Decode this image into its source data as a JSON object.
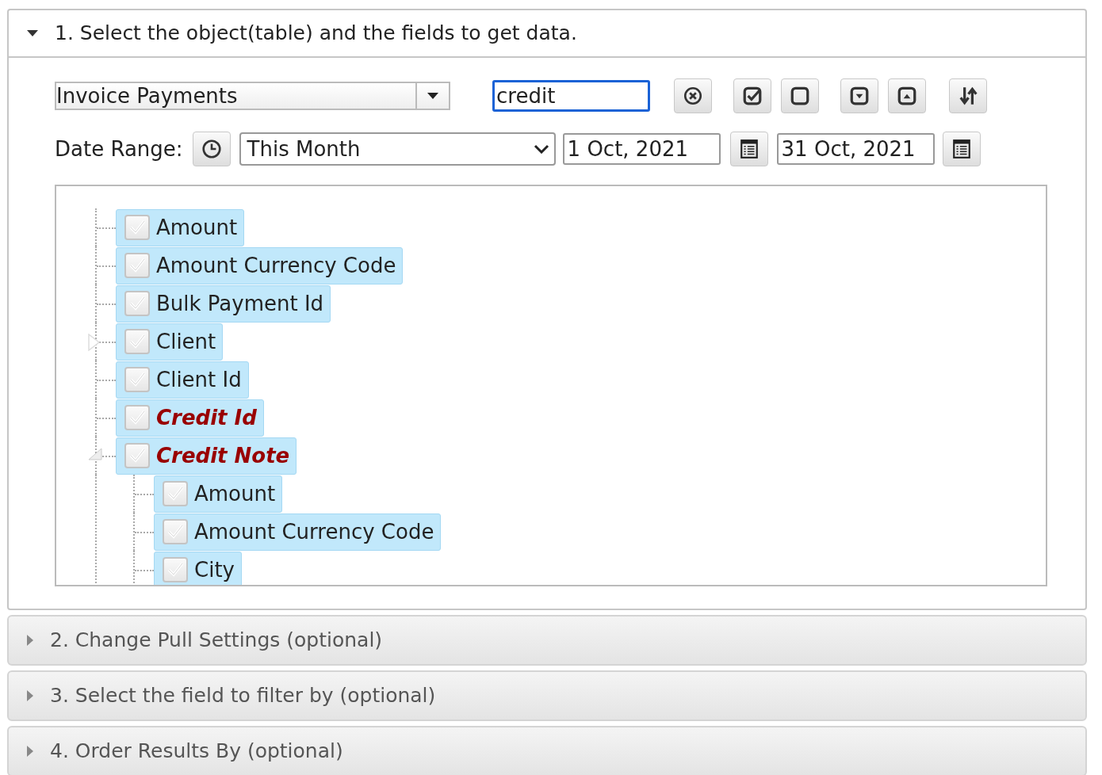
{
  "sections": [
    {
      "title": "1. Select the object(table) and the fields to get data.",
      "expanded": true
    },
    {
      "title": "2. Change Pull Settings (optional)",
      "expanded": false
    },
    {
      "title": "3. Select the field to filter by (optional)",
      "expanded": false
    },
    {
      "title": "4. Order Results By (optional)",
      "expanded": false
    }
  ],
  "object_select": {
    "value": "Invoice Payments"
  },
  "search": {
    "value": "credit",
    "focused": true
  },
  "toolbar": [
    {
      "kind": "clear"
    },
    {
      "kind": "check-all"
    },
    {
      "kind": "uncheck-all"
    },
    {
      "kind": "expand-all"
    },
    {
      "kind": "collapse-all"
    },
    {
      "kind": "sort"
    }
  ],
  "date_range": {
    "label": "Date Range:",
    "preset": "This Month",
    "from": "1 Oct, 2021",
    "to": "31 Oct, 2021"
  },
  "tree": [
    {
      "label": "Amount",
      "kind": "leaf",
      "checked": true,
      "selected": true,
      "match": false
    },
    {
      "label": "Amount Currency Code",
      "kind": "leaf",
      "checked": true,
      "selected": true,
      "match": false
    },
    {
      "label": "Bulk Payment Id",
      "kind": "leaf",
      "checked": true,
      "selected": true,
      "match": false
    },
    {
      "label": "Client",
      "kind": "branch",
      "expanded": false,
      "checked": true,
      "selected": true,
      "match": false
    },
    {
      "label": "Client Id",
      "kind": "leaf",
      "checked": true,
      "selected": true,
      "match": false
    },
    {
      "label": "Credit Id",
      "kind": "leaf",
      "checked": true,
      "selected": true,
      "match": true
    },
    {
      "label": "Credit Note",
      "kind": "branch",
      "expanded": true,
      "checked": true,
      "selected": true,
      "match": true,
      "children": [
        {
          "label": "Amount",
          "kind": "leaf",
          "checked": true,
          "selected": true,
          "match": false
        },
        {
          "label": "Amount Currency Code",
          "kind": "leaf",
          "checked": true,
          "selected": true,
          "match": false
        },
        {
          "label": "City",
          "kind": "leaf",
          "checked": true,
          "selected": true,
          "match": false
        }
      ]
    }
  ]
}
